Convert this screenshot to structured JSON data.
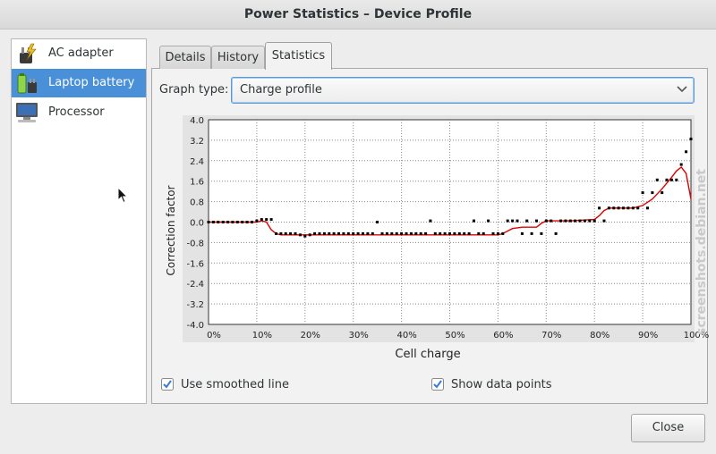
{
  "window": {
    "title": "Power Statistics – Device Profile"
  },
  "sidebar": {
    "items": [
      {
        "label": "AC adapter",
        "icon": "ac-adapter-icon",
        "selected": false
      },
      {
        "label": "Laptop battery",
        "icon": "battery-icon",
        "selected": true
      },
      {
        "label": "Processor",
        "icon": "computer-icon",
        "selected": false
      }
    ]
  },
  "tabs": [
    {
      "label": "Details"
    },
    {
      "label": "History"
    },
    {
      "label": "Statistics",
      "active": true
    }
  ],
  "graph_type": {
    "label": "Graph type:",
    "value": "Charge profile"
  },
  "options": {
    "smoothed": {
      "label": "Use smoothed line",
      "checked": true
    },
    "points": {
      "label": "Show data points",
      "checked": true
    }
  },
  "close_label": "Close",
  "watermark": "screenshots.debian.net",
  "colors": {
    "selection": "#4a90d9",
    "line": "#e00000",
    "points": "#000000"
  },
  "chart_data": {
    "type": "line",
    "xlabel": "Cell charge",
    "ylabel": "Correction factor",
    "xlim": [
      0,
      100
    ],
    "ylim": [
      -4.0,
      4.0
    ],
    "grid": true,
    "x_ticks": [
      "0%",
      "10%",
      "20%",
      "30%",
      "40%",
      "50%",
      "60%",
      "70%",
      "80%",
      "90%",
      "100%"
    ],
    "y_ticks": [
      "4.0",
      "3.2",
      "2.4",
      "1.6",
      "0.8",
      "0.0",
      "-0.8",
      "-1.6",
      "-2.4",
      "-3.2",
      "-4.0"
    ],
    "series": [
      {
        "kind": "line",
        "x": [
          0,
          5,
          10,
          11,
          12,
          13,
          14,
          15,
          16,
          18,
          20,
          22,
          25,
          30,
          40,
          50,
          55,
          58,
          60,
          61,
          62,
          63,
          65,
          68,
          69,
          70,
          72,
          75,
          80,
          81,
          82,
          83,
          85,
          88,
          90,
          92,
          94,
          96,
          97,
          98,
          99,
          100
        ],
        "y": [
          0,
          0,
          0,
          0.05,
          0,
          -0.3,
          -0.45,
          -0.5,
          -0.5,
          -0.5,
          -0.5,
          -0.5,
          -0.5,
          -0.5,
          -0.5,
          -0.5,
          -0.5,
          -0.5,
          -0.5,
          -0.45,
          -0.35,
          -0.25,
          -0.2,
          -0.2,
          -0.05,
          0.05,
          0.05,
          0.05,
          0.1,
          0.25,
          0.45,
          0.55,
          0.55,
          0.55,
          0.65,
          0.9,
          1.3,
          1.75,
          2.0,
          2.15,
          1.9,
          0.9
        ]
      },
      {
        "kind": "points",
        "x": [
          0,
          1,
          2,
          3,
          4,
          5,
          6,
          7,
          8,
          9,
          10,
          11,
          12,
          13,
          14,
          15,
          16,
          17,
          18,
          19,
          20,
          21,
          22,
          23,
          24,
          25,
          26,
          27,
          28,
          29,
          30,
          31,
          32,
          33,
          34,
          35,
          36,
          37,
          38,
          39,
          40,
          41,
          42,
          43,
          44,
          45,
          46,
          47,
          48,
          49,
          50,
          51,
          52,
          53,
          54,
          55,
          56,
          57,
          58,
          59,
          60,
          61,
          62,
          63,
          64,
          65,
          66,
          67,
          68,
          69,
          70,
          71,
          72,
          73,
          74,
          75,
          76,
          77,
          78,
          79,
          80,
          81,
          82,
          83,
          84,
          85,
          86,
          87,
          88,
          89,
          90,
          91,
          92,
          93,
          94,
          95,
          96,
          97,
          98,
          99,
          100
        ],
        "y": [
          0,
          0,
          0,
          0,
          0,
          0,
          0,
          0,
          0,
          0,
          0.05,
          0.1,
          0.1,
          0.1,
          -0.45,
          -0.45,
          -0.45,
          -0.45,
          -0.45,
          -0.5,
          -0.55,
          -0.5,
          -0.45,
          -0.45,
          -0.45,
          -0.45,
          -0.45,
          -0.45,
          -0.45,
          -0.45,
          -0.45,
          -0.45,
          -0.45,
          -0.45,
          -0.45,
          0.0,
          -0.45,
          -0.45,
          -0.45,
          -0.45,
          -0.45,
          -0.45,
          -0.45,
          -0.45,
          -0.45,
          -0.45,
          0.05,
          -0.45,
          -0.45,
          -0.45,
          -0.45,
          -0.45,
          -0.45,
          -0.45,
          -0.45,
          0.05,
          -0.45,
          -0.45,
          0.05,
          -0.45,
          -0.45,
          -0.45,
          0.05,
          0.05,
          0.05,
          -0.45,
          0.05,
          -0.45,
          0.05,
          -0.45,
          0.05,
          0.05,
          -0.45,
          0.05,
          0.05,
          0.05,
          0.05,
          0.05,
          0.05,
          0.05,
          0.05,
          0.55,
          0.05,
          0.55,
          0.55,
          0.55,
          0.55,
          0.55,
          0.55,
          0.55,
          1.15,
          0.55,
          1.15,
          1.65,
          1.15,
          1.65,
          1.65,
          1.65,
          2.25,
          2.75,
          3.25
        ]
      }
    ]
  }
}
